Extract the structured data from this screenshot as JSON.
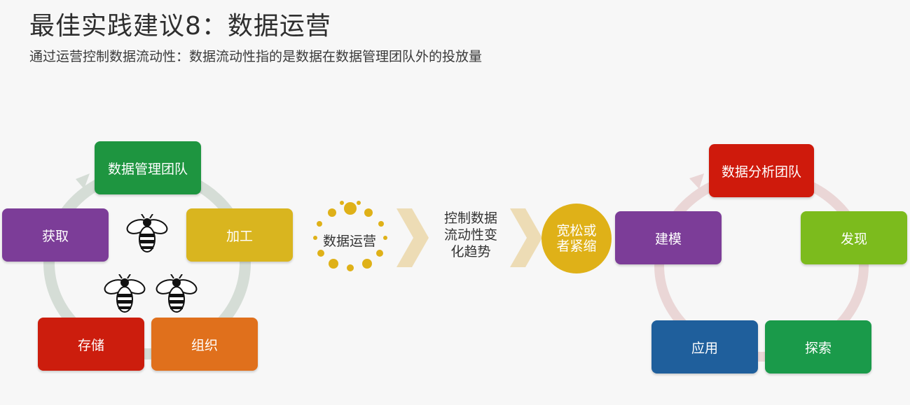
{
  "header": {
    "title": "最佳实践建议8：数据运营",
    "subtitle": "通过运营控制数据流动性：数据流动性指的是数据在数据管理团队外的投放量"
  },
  "left_cycle": {
    "top": "数据管理团队",
    "left": "获取",
    "right": "加工",
    "bottom_left": "存储",
    "bottom_right": "组织"
  },
  "middle": {
    "dots_label": "数据运营",
    "flow_label_lines": [
      "控制数据",
      "流动性变",
      "化趋势"
    ],
    "circle_label_lines": [
      "宽松或",
      "者紧缩"
    ]
  },
  "right_cycle": {
    "top": "数据分析团队",
    "left": "建模",
    "right": "发现",
    "bottom_left": "应用",
    "bottom_right": "探索"
  },
  "colors": {
    "green": "#1e9540",
    "purple": "#7c3d98",
    "yellow": "#d9b51f",
    "red": "#cc1d0d",
    "orange": "#e0701c",
    "red_team": "#cf1a0c",
    "lime": "#7cbb1d",
    "blue": "#1f5f9c",
    "teal_green": "#1a9a4a",
    "gold": "#dfb118"
  }
}
